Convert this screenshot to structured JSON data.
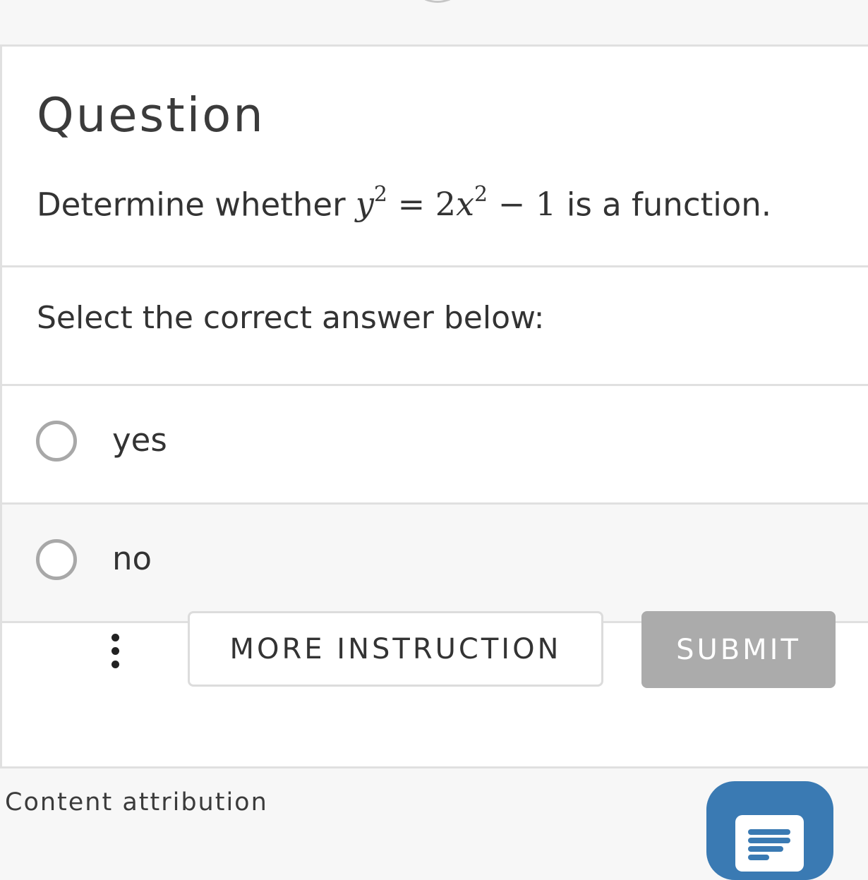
{
  "question": {
    "heading": "Question",
    "text_before": "Determine whether ",
    "math": {
      "lhs_var": "y",
      "lhs_exp": "2",
      "equals": " = ",
      "coef": "2",
      "rhs_var": "x",
      "rhs_exp": "2",
      "minus": " − ",
      "const": "1"
    },
    "text_after": " is a function."
  },
  "prompt": "Select the correct answer below:",
  "options": [
    {
      "label": "yes",
      "selected": false
    },
    {
      "label": "no",
      "selected": false
    }
  ],
  "actions": {
    "more_label": "MORE INSTRUCTION",
    "submit_label": "SUBMIT"
  },
  "footer": {
    "attribution": "Content attribution"
  },
  "icons": {
    "menu": "vertical-dots-icon",
    "feedback": "document-icon"
  },
  "colors": {
    "accent": "#3a7ab3",
    "submit_disabled": "#ababab",
    "radio_border": "#a8a8a8"
  }
}
